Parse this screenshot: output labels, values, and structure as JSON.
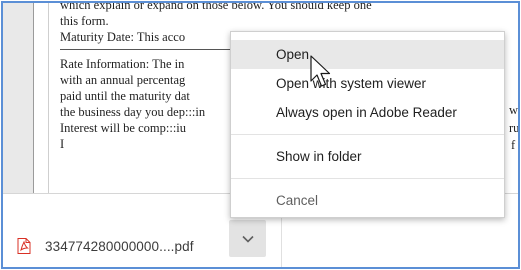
{
  "document": {
    "lines": [
      "which explain or expand on those below.  You should keep one",
      "this form.",
      "Maturity Date: This acco",
      "Rate Information: The in",
      "with an annual percentag",
      "paid until the maturity dat",
      "the business day you dep:::in",
      "Interest will be comp:::iu",
      "I"
    ],
    "right_fragments": [
      "w",
      "ru",
      "f"
    ]
  },
  "download": {
    "filename": "334774280000000....pdf"
  },
  "context_menu": {
    "items": [
      {
        "label": "Open"
      },
      {
        "label": "Open with system viewer"
      },
      {
        "label": "Always open in Adobe Reader"
      },
      {
        "label": "Show in folder"
      },
      {
        "label": "Cancel"
      }
    ]
  },
  "colors": {
    "frame_border": "#5b8fd6",
    "pdf_icon": "#d93025",
    "menu_hover": "#e8e8e8"
  },
  "icons": {
    "file_type": "pdf-icon",
    "dropdown": "chevron-down-icon",
    "pointer": "mouse-cursor-icon"
  }
}
